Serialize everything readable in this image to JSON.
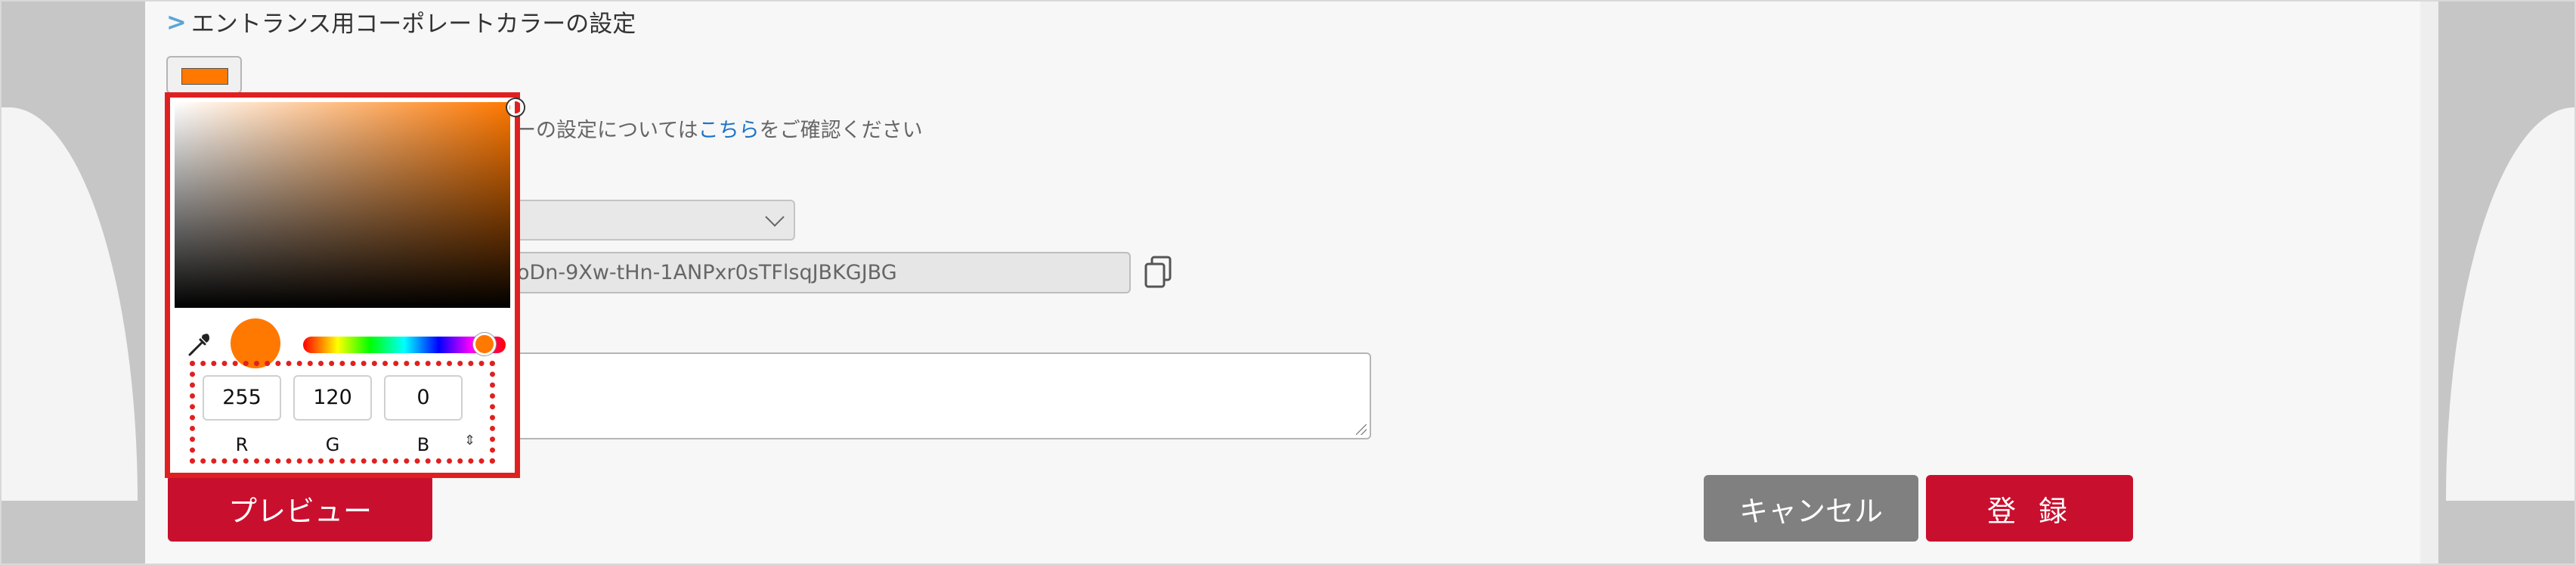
{
  "section": {
    "title": "エントランス用コーポレートカラーの設定"
  },
  "corporate_color": {
    "swatch_color": "#ff7800",
    "note_text": "ーの設定については",
    "note_link": "こちら",
    "note_suffix": "をご確認ください"
  },
  "form": {
    "select_value": "",
    "api_key_fragment": "oDn-9Xw-tHn-1ANPxr0sTFlsqJBKGJBG",
    "textarea_value": ""
  },
  "color_picker": {
    "color": "#ff7800",
    "r": "255",
    "g": "120",
    "b": "0",
    "labels": {
      "r": "R",
      "g": "G",
      "b": "B"
    },
    "mode_toggle": "⇕"
  },
  "buttons": {
    "preview": "プレビュー",
    "cancel": "キャンセル",
    "register": "登録"
  },
  "colors": {
    "accent_red": "#c8102e",
    "highlight_red": "#e02020",
    "link_blue": "#1a73c8",
    "cancel_gray": "#808080"
  }
}
